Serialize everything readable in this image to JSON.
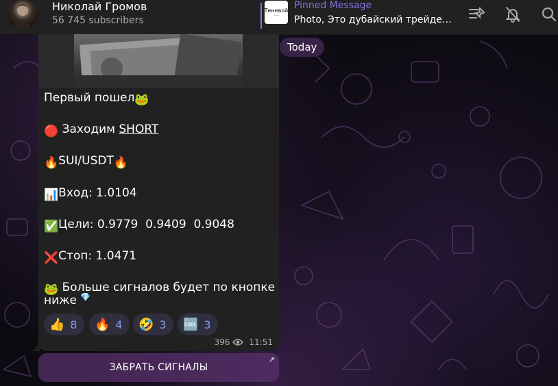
{
  "header": {
    "channel_name": "Николай Громов",
    "subscribers": "56 745 subscribers",
    "pinned": {
      "title": "Pinned Message",
      "text": "Photo, Это дубайский трейде…",
      "thumb_text": "Теневой"
    },
    "icons": [
      "pinned-list-icon",
      "mute-bell-icon",
      "search-icon"
    ]
  },
  "date_badge": "Today",
  "message": {
    "lines": {
      "first": "Первый пошел",
      "short_prefix": "Заходим ",
      "short_word": "SHORT",
      "pair": "SUI/USDT",
      "entry": "Вход: 1.0104",
      "targets": "Цели: 0.9779  0.9409  0.9048",
      "stop": "Стоп: 1.0471",
      "more_1": "Больше сигналов будет по кнопке",
      "more_2": "ниже"
    },
    "reactions": [
      {
        "emoji": "👍",
        "count": "8"
      },
      {
        "emoji": "🔥",
        "count": "4"
      },
      {
        "emoji": "🤣",
        "count": "3"
      },
      {
        "emoji": "🆒",
        "count": "3"
      }
    ],
    "views": "396",
    "time": "11:51"
  },
  "keyboard_button": {
    "label": "ЗАБРАТЬ СИГНАЛЫ",
    "arrow": "↗"
  },
  "colors": {
    "accent": "#8774e1",
    "bubble": "#212121",
    "header": "#212121",
    "date_badge": "#3a2348",
    "button": "#5a326e"
  }
}
